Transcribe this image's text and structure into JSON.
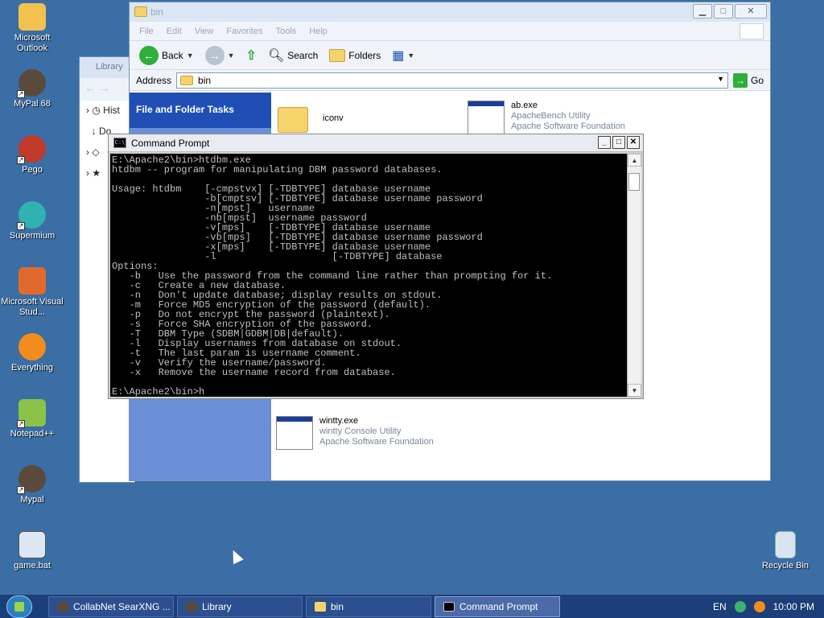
{
  "desktop": {
    "icons": [
      {
        "label": "Microsoft Outlook",
        "icon": "outlook-icon",
        "color": "#f2c14e"
      },
      {
        "label": "MyPal 68",
        "icon": "mypal-icon",
        "color": "#5b4a3b"
      },
      {
        "label": "Pego",
        "icon": "pego-icon",
        "color": "#c0392b"
      },
      {
        "label": "Supermium",
        "icon": "supermium-icon",
        "color": "#2eb3b0"
      },
      {
        "label": "Microsoft Visual Stud...",
        "icon": "visual-studio-icon",
        "color": "#e06a2e"
      },
      {
        "label": "Everything",
        "icon": "everything-icon",
        "color": "#f28c1c"
      },
      {
        "label": "Notepad++",
        "icon": "notepadpp-icon",
        "color": "#8bc34a"
      },
      {
        "label": "Mypal",
        "icon": "mypal-icon",
        "color": "#5b4a3b"
      },
      {
        "label": "game.bat",
        "icon": "batch-file-icon",
        "color": "#dde6f2"
      }
    ],
    "recycle_bin": {
      "label": "Recycle Bin",
      "icon": "recycle-bin-icon"
    }
  },
  "library_window": {
    "title": "Library",
    "tree": [
      {
        "label": "Hist",
        "icon": "clock-icon"
      },
      {
        "label": "Do...",
        "icon": "download-icon"
      },
      {
        "label": "",
        "icon": "tag-icon"
      },
      {
        "label": "",
        "icon": "star-icon"
      }
    ]
  },
  "explorer": {
    "title": "bin",
    "menu": [
      "File",
      "Edit",
      "View",
      "Favorites",
      "Tools",
      "Help"
    ],
    "toolbar": {
      "back": "Back",
      "search": "Search",
      "folders": "Folders"
    },
    "address": {
      "label": "Address",
      "value": "bin",
      "go": "Go"
    },
    "taskpane": {
      "title": "File and Folder Tasks"
    },
    "files": [
      {
        "name": "iconv",
        "type": "folder",
        "desc": "",
        "company": ""
      },
      {
        "name": "ab.exe",
        "type": "exe",
        "desc": "ApacheBench Utility",
        "company": "Apache Software Foundation"
      },
      {
        "name": "wintty.exe",
        "type": "exe",
        "desc": "wintty Console Utility",
        "company": "Apache Software Foundation"
      }
    ]
  },
  "cmd": {
    "title": "Command Prompt",
    "icon_text": "C:\\",
    "lines": [
      "E:\\Apache2\\bin>htdbm.exe",
      "htdbm -- program for manipulating DBM password databases.",
      "",
      "Usage: htdbm    [-cmpstvx] [-TDBTYPE] database username",
      "                -b[cmptsv] [-TDBTYPE] database username password",
      "                -n[mpst]   username",
      "                -nb[mpst]  username password",
      "                -v[mps]    [-TDBTYPE] database username",
      "                -vb[mps]   [-TDBTYPE] database username password",
      "                -x[mps]    [-TDBTYPE] database username",
      "                -l                    [-TDBTYPE] database",
      "Options:",
      "   -b   Use the password from the command line rather than prompting for it.",
      "   -c   Create a new database.",
      "   -n   Don't update database; display results on stdout.",
      "   -m   Force MD5 encryption of the password (default).",
      "   -p   Do not encrypt the password (plaintext).",
      "   -s   Force SHA encryption of the password.",
      "   -T   DBM Type (SDBM|GDBM|DB|default).",
      "   -l   Display usernames from database on stdout.",
      "   -t   The last param is username comment.",
      "   -v   Verify the username/password.",
      "   -x   Remove the username record from database.",
      "",
      "E:\\Apache2\\bin>h"
    ]
  },
  "taskbar": {
    "buttons": [
      {
        "label": "CollabNet SearXNG ...",
        "icon": "mypal-icon",
        "active": false
      },
      {
        "label": "Library",
        "icon": "mypal-icon",
        "active": false
      },
      {
        "label": "bin",
        "icon": "folder-icon",
        "active": false
      },
      {
        "label": "Command Prompt",
        "icon": "cmd-icon",
        "active": true
      }
    ],
    "language": "EN",
    "clock": "10:00 PM"
  }
}
